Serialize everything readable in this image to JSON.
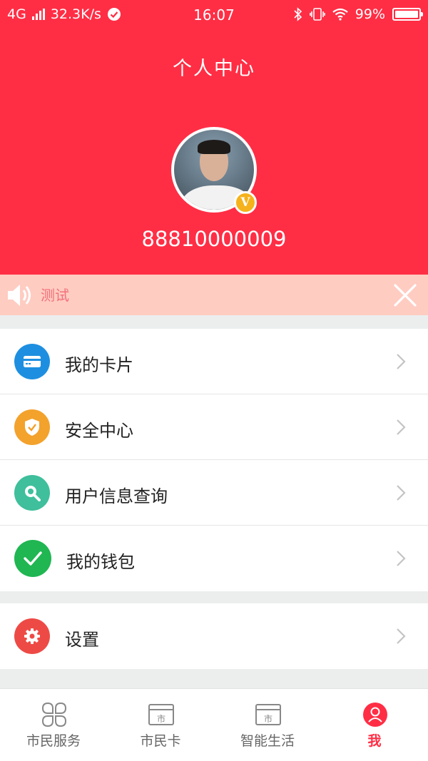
{
  "status_bar": {
    "network": "4G",
    "speed": "32.3K/s",
    "time": "16:07",
    "battery": "99%",
    "battery_level": 0.99,
    "icons": [
      "signal-icon",
      "check-circle-icon",
      "bluetooth-icon",
      "vibrate-icon",
      "wifi-icon",
      "battery-icon"
    ]
  },
  "header": {
    "title": "个人中心",
    "vip_badge": "V",
    "account_number": "88810000009"
  },
  "notice": {
    "text": "测试",
    "icons": [
      "speaker-icon",
      "close-icon"
    ]
  },
  "menu_groups": [
    [
      {
        "label": "我的卡片",
        "icon": "card-icon",
        "color": "#1e8fe0"
      },
      {
        "label": "安全中心",
        "icon": "shield-icon",
        "color": "#f3a22c"
      },
      {
        "label": "用户信息查询",
        "icon": "search-icon",
        "color": "#3fbf9c"
      },
      {
        "label": "我的钱包",
        "icon": "check-icon",
        "color": "#20b652"
      }
    ],
    [
      {
        "label": "设置",
        "icon": "gear-icon",
        "color": "#ee4a45"
      }
    ]
  ],
  "tabs": [
    {
      "label": "市民服务",
      "icon": "grid-icon",
      "active": false
    },
    {
      "label": "市民卡",
      "icon": "citizen-card-icon",
      "active": false
    },
    {
      "label": "智能生活",
      "icon": "smart-life-icon",
      "active": false
    },
    {
      "label": "我",
      "icon": "user-icon",
      "active": true
    }
  ],
  "colors": {
    "brand_red": "#ff2e45",
    "notice_bg": "#ffccc2",
    "notice_text": "#f2707a",
    "inactive_tab": "#888888"
  }
}
